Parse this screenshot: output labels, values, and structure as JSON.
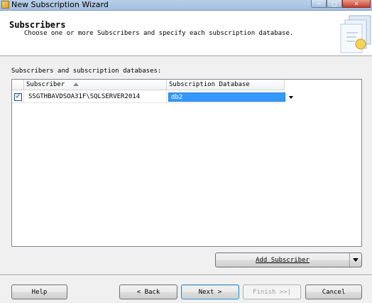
{
  "window": {
    "title": "New Subscription Wizard"
  },
  "header": {
    "title": "Subscribers",
    "subtitle": "Choose one or more Subscribers and specify each subscription database."
  },
  "group_label": "Subscribers and subscription databases:",
  "grid": {
    "columns": {
      "subscriber": "Subscriber",
      "database": "Subscription Database"
    },
    "rows": [
      {
        "checked": true,
        "subscriber": "SSGTHBAVDSOA31F\\SQLSERVER2014",
        "database": "db2"
      }
    ]
  },
  "buttons": {
    "add_subscriber": "Add Subscriber",
    "help": "Help",
    "back": "< Back",
    "next": "Next >",
    "finish": "Finish >>|",
    "cancel": "Cancel"
  },
  "icons": {
    "check": "check-icon",
    "sort": "sort-ascending-icon",
    "dropdown": "chevron-down-icon",
    "wizard": "wizard-graphic-icon"
  }
}
